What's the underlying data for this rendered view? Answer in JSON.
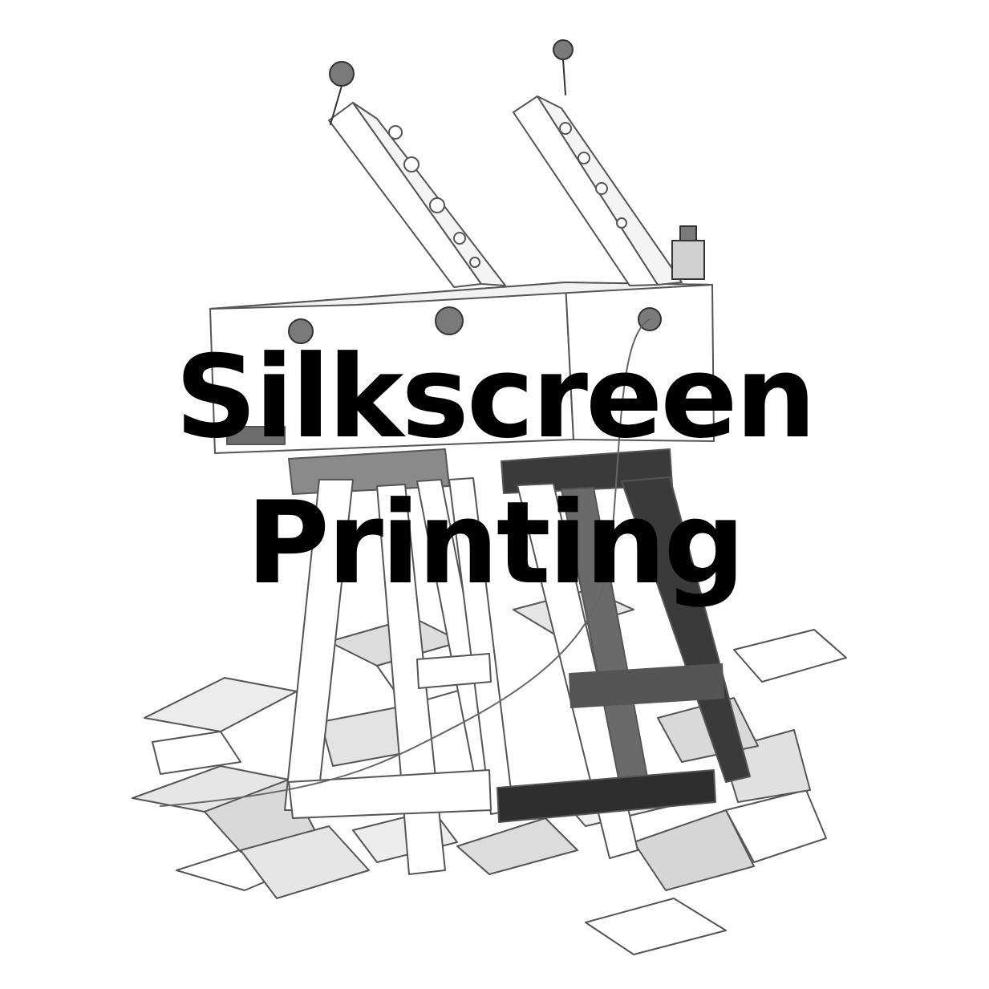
{
  "title": {
    "line1": "Silkscreen",
    "line2": "Printing"
  },
  "illustration": {
    "icon": "silkscreen-press-on-sawhorses-pencil-drawing"
  },
  "colors": {
    "background": "#ffffff",
    "text": "#000000",
    "pencil": "#555555",
    "shade_dark": "#3a3a3a",
    "shade_mid": "#bdbdbd"
  }
}
